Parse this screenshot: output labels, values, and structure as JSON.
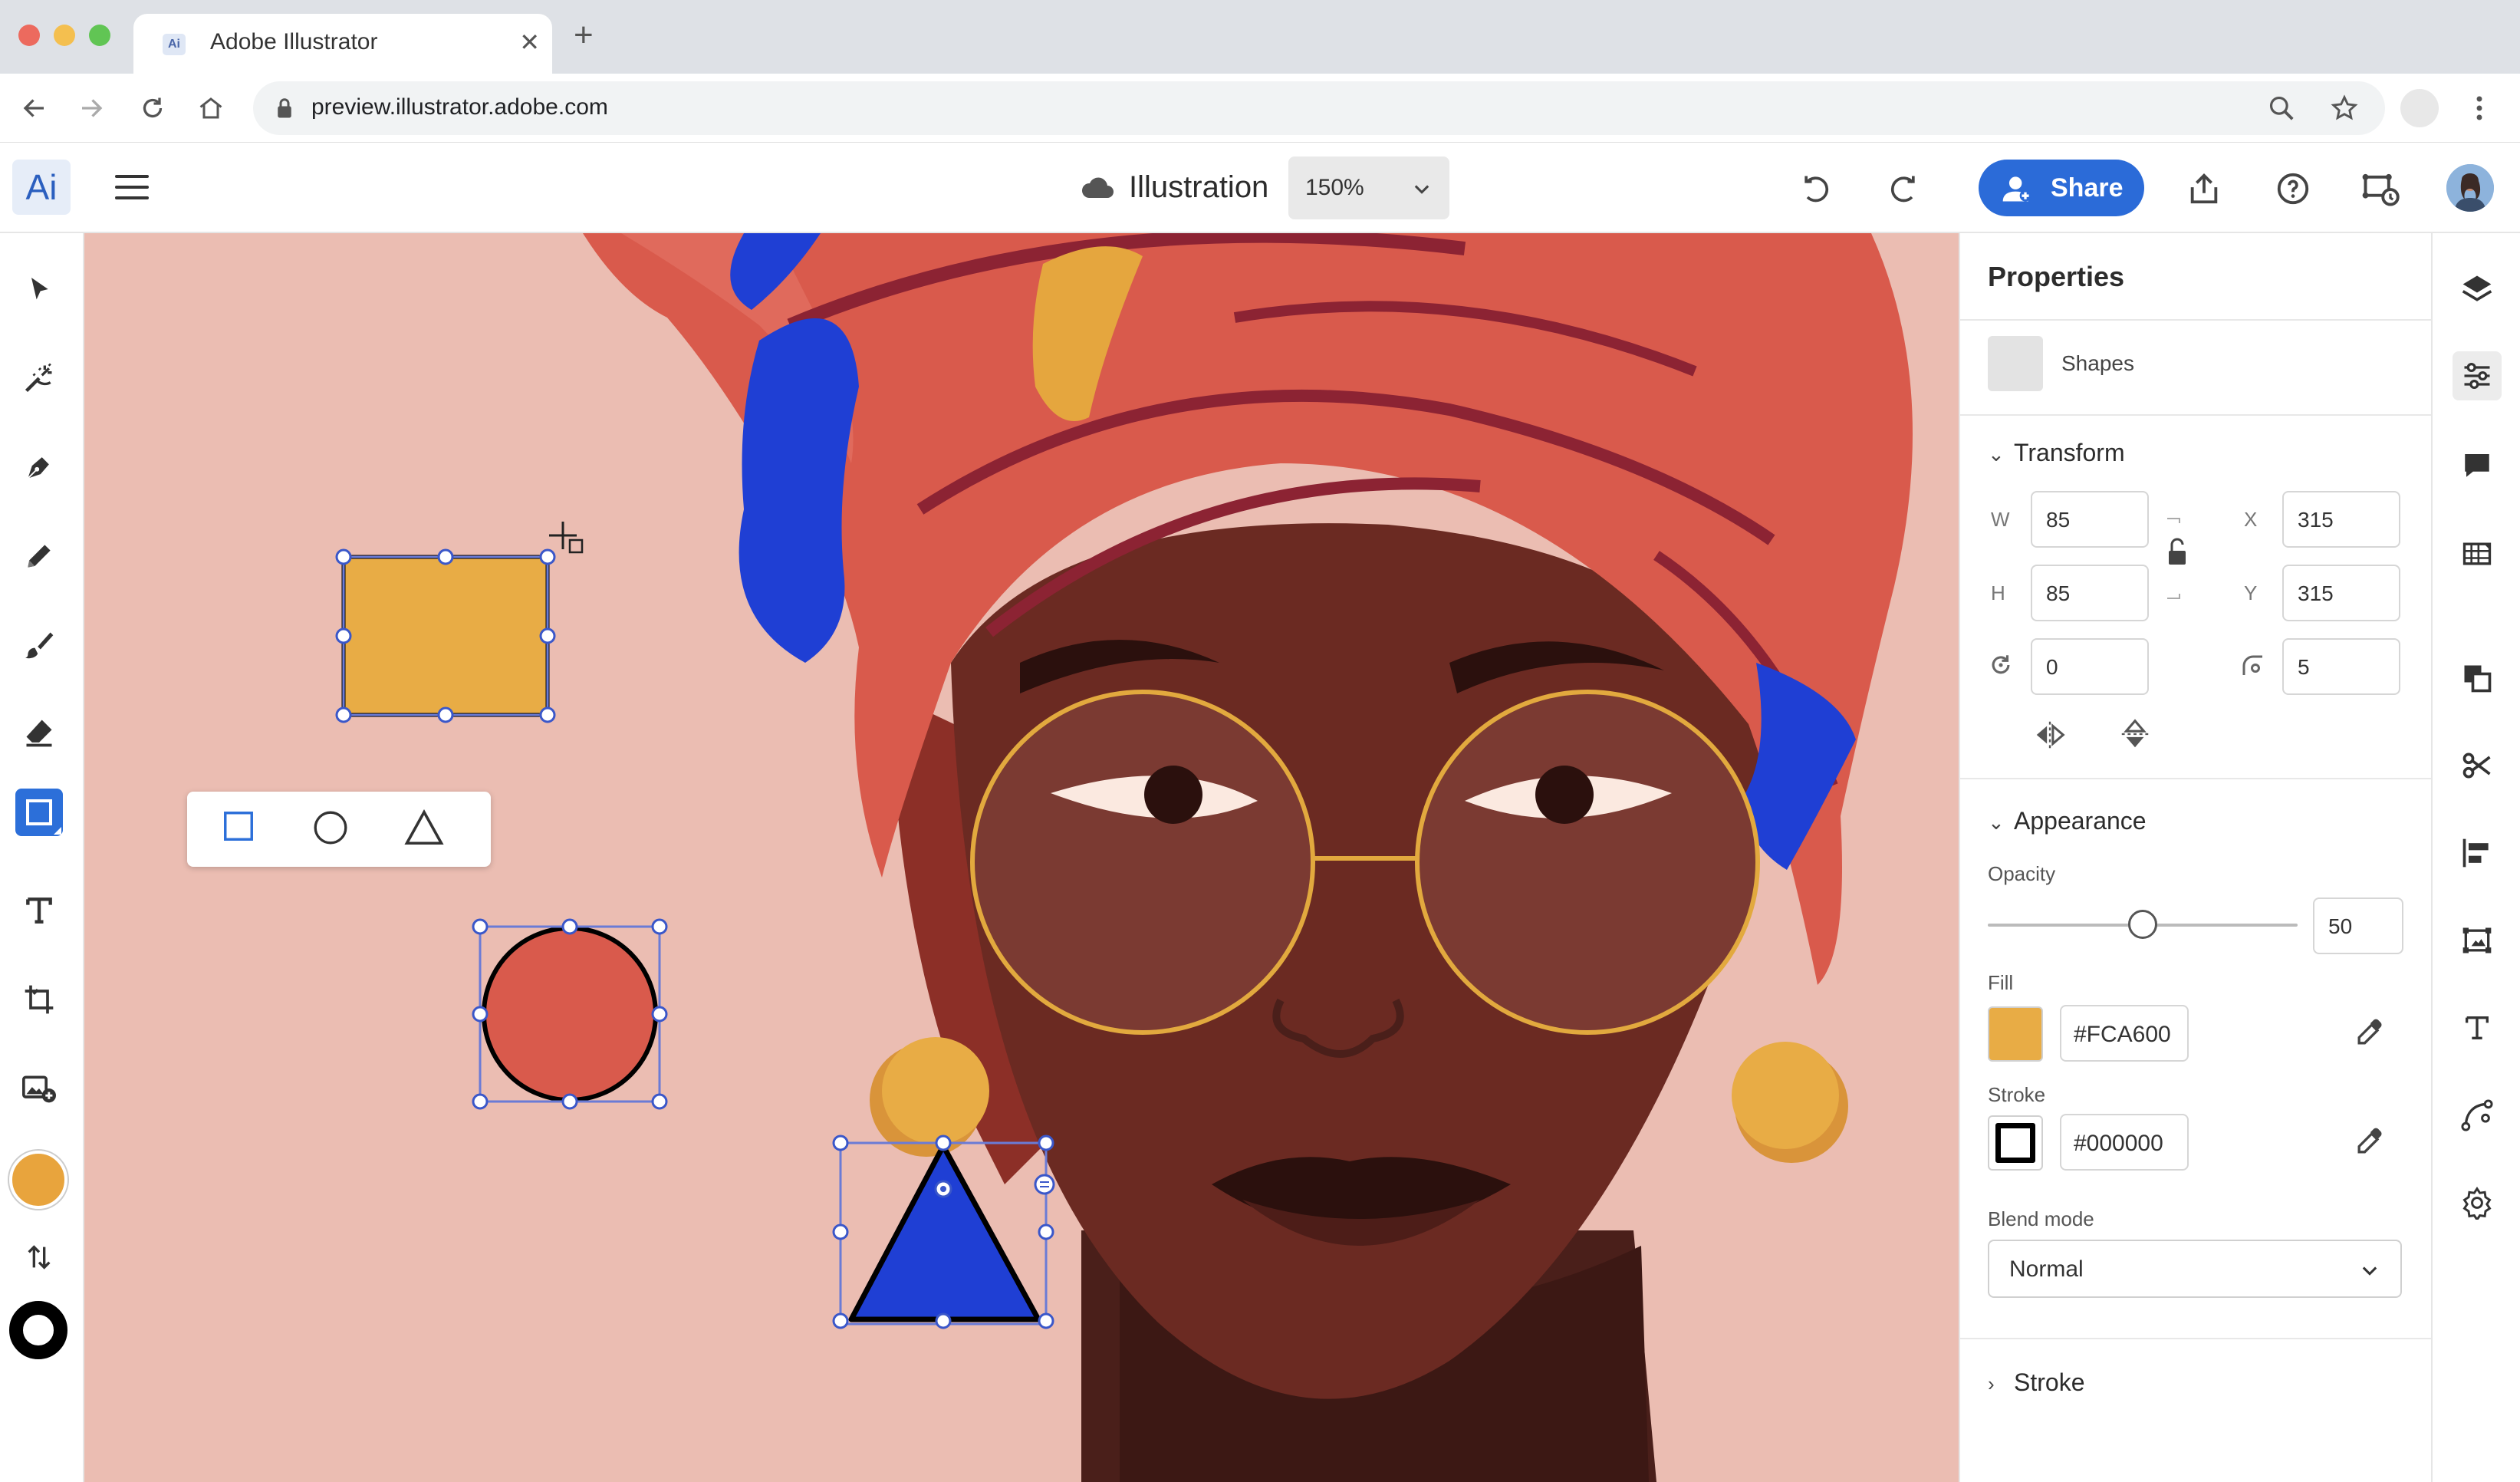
{
  "browser": {
    "tab_title": "Adobe Illustrator",
    "favicon_text": "Ai",
    "url": "preview.illustrator.adobe.com"
  },
  "app": {
    "logo": "Ai",
    "doc_title": "Illustration",
    "zoom": "150%",
    "share_label": "Share"
  },
  "left_tools": [
    "selection-tool",
    "magic-tool",
    "pen-tool",
    "pencil-tool",
    "paint-brush-tool",
    "eraser-tool",
    "shape-tool",
    "type-tool",
    "crop-tool",
    "place-image-tool"
  ],
  "colors": {
    "fill": "#FCA600",
    "stroke": "#000000",
    "accent": "#2B6BD8",
    "canvas_bg": "#EBBDB2"
  },
  "properties": {
    "title": "Properties",
    "selection_label": "Shapes",
    "transform": {
      "title": "Transform",
      "w_label": "W",
      "w": "85",
      "h_label": "H",
      "h": "85",
      "x_label": "X",
      "x": "315",
      "y_label": "Y",
      "y": "315",
      "rotation": "0",
      "corner_radius": "5"
    },
    "appearance": {
      "title": "Appearance",
      "opacity_label": "Opacity",
      "opacity": "50",
      "fill_label": "Fill",
      "fill_hex": "#FCA600",
      "stroke_label": "Stroke",
      "stroke_hex": "#000000",
      "blend_label": "Blend mode",
      "blend_value": "Normal"
    },
    "stroke_section": "Stroke"
  }
}
